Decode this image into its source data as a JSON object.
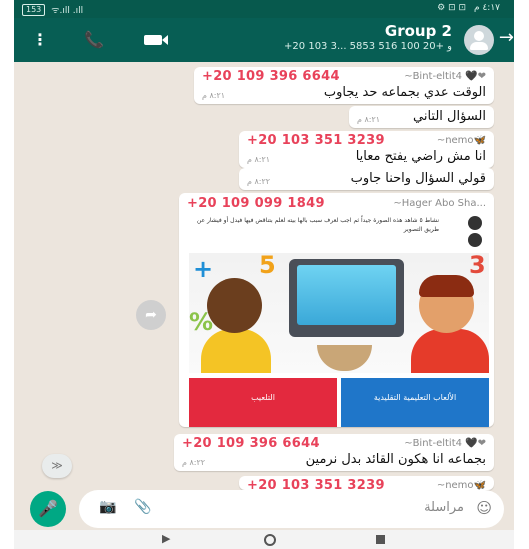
{
  "status_bar": {
    "battery": "153",
    "signal": "ᯤ.ıll .ıll",
    "time": "٤:١٧ م",
    "icons": "⚙ ⊡ ⊡"
  },
  "header": {
    "more_icon": "⋮",
    "call_icon": "📞",
    "group_name": "Group 2",
    "members": "+20 103 3... و +20 100 516 5853",
    "back_icon": "→"
  },
  "messages": [
    {
      "nick": "~Bint-eltit4 🖤❤",
      "phone": "+20 109 396 6644",
      "text": "الوقت عدي بجماعه حد يجاوب",
      "time": "٨:٢١ م"
    },
    {
      "text": "السؤال التاني",
      "time": "٨:٢١ م"
    },
    {
      "nick": "~nemo🦋",
      "phone": "+20 103 351 3239",
      "text": "انا مش راضي يفتح معايا",
      "time": "٨:٢١ م"
    },
    {
      "text": "قولي السؤال واحنا جاوب",
      "time": "٨:٢٢ م"
    }
  ],
  "image_message": {
    "nick": "~Hager Abo Sha...",
    "phone": "+20 109 099 1849",
    "caption": "نشاط ٥ شاهد هذه الصورة جيداً ثم اجب لعرف سبب بالها بيته لعلم بتناقض فيها فيدل أو فيشار عن طريق التصوير",
    "tile_left": "التلعيب",
    "tile_right": "الألعاب التعليمية التقليدية",
    "time": "٨:٢٢ م"
  },
  "message_last": {
    "nick": "~Bint-eltit4 🖤❤",
    "phone": "+20 109 396 6644",
    "text": "بجماعه انا هكون القائد بدل نرمين",
    "time": "٨:٢٢ م"
  },
  "message_partial": {
    "nick": "~nemo🦋",
    "phone": "+20 103 351 3239"
  },
  "composer": {
    "placeholder": "مراسلة",
    "mic_icon": "🎤",
    "camera_icon": "📷",
    "attach_icon": "📎",
    "emoji_icon": "☺"
  },
  "forward_icon": "➦",
  "scroll_down_icon": "≫"
}
